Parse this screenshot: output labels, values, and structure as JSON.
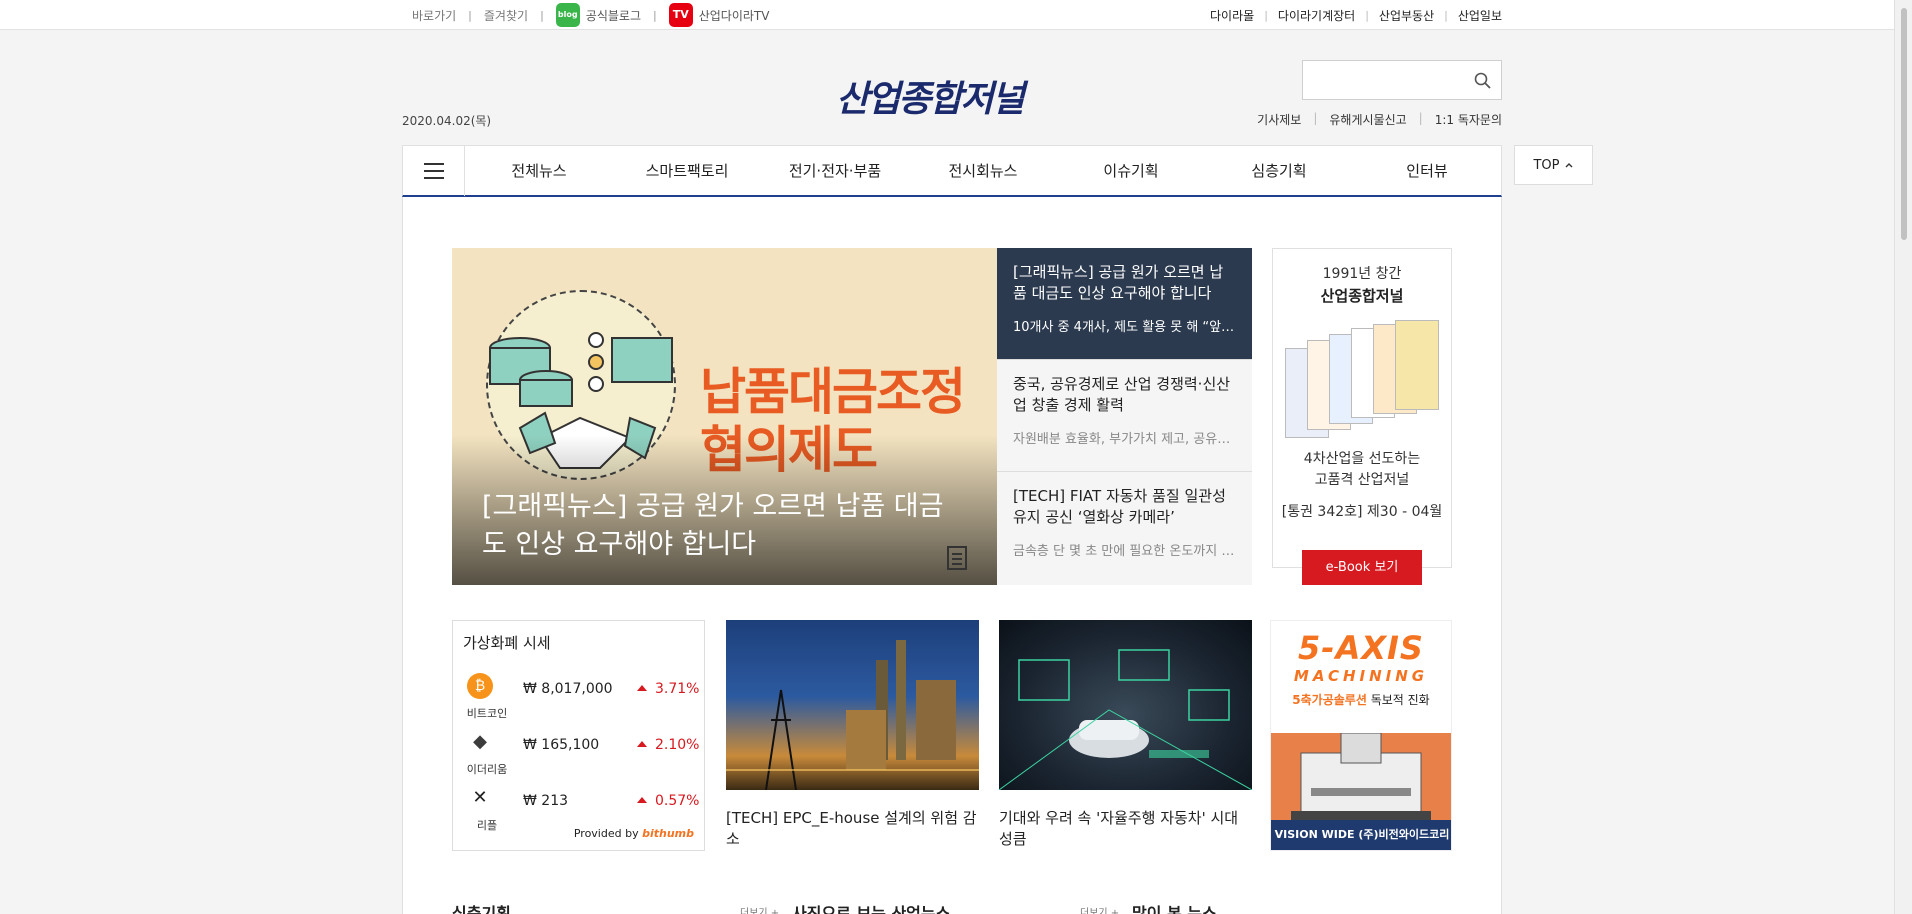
{
  "topbar": {
    "left_links": [
      "바로가기",
      "즐겨찾기"
    ],
    "blog_label": "공식블로그",
    "blog_icon_text": "blog",
    "tv_label": "산업다이라TV",
    "tv_icon_text": "TV",
    "right_links": [
      "다이라몰",
      "다이라기계장터",
      "산업부동산",
      "산업일보"
    ]
  },
  "header": {
    "date": "2020.04.02(목)",
    "logo": "산업종합저널",
    "search_placeholder": "",
    "links": [
      "기사제보",
      "유해게시물신고",
      "1:1 독자문의"
    ]
  },
  "nav": {
    "items": [
      "전체뉴스",
      "스마트팩토리",
      "전기·전자·부품",
      "전시회뉴스",
      "이슈기획",
      "심층기획",
      "인터뷰"
    ],
    "top_button": "TOP"
  },
  "hero": {
    "image_title": "납품대금조정\n협의제도",
    "caption": "[그래픽뉴스] 공급 원가 오르면 납품 대금도 인상 요구해야 합니다"
  },
  "side_news": [
    {
      "title": "[그래픽뉴스] 공급 원가 오르면 납품 대금도 인상 요구해야 합니다",
      "desc": "10개사 중 4개사, 제도 활용 못 해 “앞…"
    },
    {
      "title": "중국, 공유경제로 산업 경쟁력·신산업 창출 경제 활력",
      "desc": "자원배분 효율화, 부가가치 제고, 공유…"
    },
    {
      "title": "[TECH] FIAT 자동차 품질 일관성 유지 공신 ‘열화상 카메라’",
      "desc": "금속층 단 몇 초 만에 필요한 온도까지 …"
    }
  ],
  "ebook": {
    "line1": "1991년 창간",
    "line2": "산업종합저널",
    "line3": "4차산업을 선도하는",
    "line4": "고품격 산업저널",
    "issue": "[통권 342호] 제30 - 04월",
    "button": "e-Book 보기"
  },
  "crypto": {
    "title": "가상화폐 시세",
    "rows": [
      {
        "name": "비트코인",
        "price": "₩ 8,017,000",
        "change": "3.71%",
        "color": "#f7931a",
        "symbol": "₿"
      },
      {
        "name": "이더리움",
        "price": "₩ 165,100",
        "change": "2.10%",
        "color": "#3c3c3d",
        "symbol": "◆"
      },
      {
        "name": "리플",
        "price": "₩ 213",
        "change": "0.57%",
        "color": "#222222",
        "symbol": "✕"
      }
    ],
    "provided_by": "Provided by",
    "provider": "bithumb"
  },
  "cards": [
    {
      "caption": "[TECH] EPC_E-house 설계의 위험 감소"
    },
    {
      "caption": "기대와 우려 속 '자율주행 자동차' 시대 성큼"
    }
  ],
  "ad": {
    "line1": "5-AXIS",
    "line2": "MACHINING",
    "line3_strong": "5축가공솔루션",
    "line3_rest": " 독보적 진화",
    "footer": "VISION WIDE (주)비전와이드코리아"
  },
  "sections": [
    {
      "title": "심층기획",
      "more": "더보기 +"
    },
    {
      "title": "사진으로 보는 산업뉴스",
      "more": "더보기 +"
    },
    {
      "title": "많이 본 뉴스",
      "more": ""
    }
  ]
}
